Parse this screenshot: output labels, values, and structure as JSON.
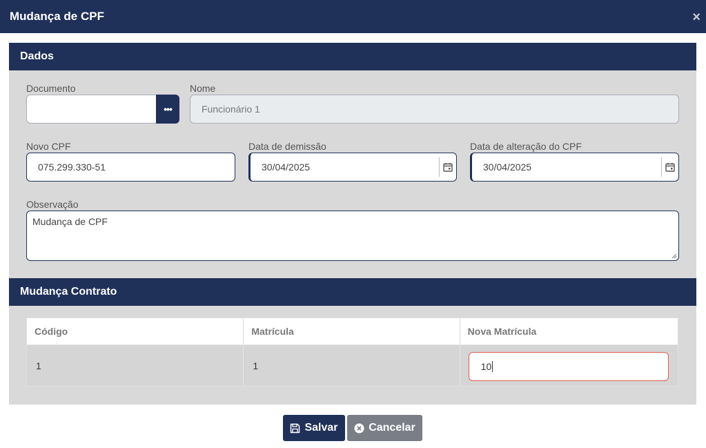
{
  "window": {
    "title": "Mudança de CPF",
    "close_glyph": "×"
  },
  "dados": {
    "header": "Dados",
    "documento": {
      "label": "Documento",
      "value": "",
      "button_glyph": "•••"
    },
    "nome": {
      "label": "Nome",
      "value": "Funcionário 1"
    },
    "novo_cpf": {
      "label": "Novo CPF",
      "value": "075.299.330-51"
    },
    "data_demissao": {
      "label": "Data de demissão",
      "value": "30/04/2025"
    },
    "data_alteracao": {
      "label": "Data de alteração do CPF",
      "value": "30/04/2025"
    },
    "observacao": {
      "label": "Observação",
      "value": "Mudança de CPF"
    }
  },
  "contrato": {
    "header": "Mudança Contrato",
    "columns": [
      "Código",
      "Matrícula",
      "Nova Matrícula"
    ],
    "rows": [
      {
        "codigo": "1",
        "matricula": "1",
        "nova_matricula": "10"
      }
    ]
  },
  "actions": {
    "save_label": "Salvar",
    "cancel_label": "Cancelar"
  },
  "colors": {
    "primary": "#1f3059",
    "section_bg": "#d9d9d9",
    "error_border": "#e25c4a",
    "cancel_bg": "#7a7f87"
  }
}
